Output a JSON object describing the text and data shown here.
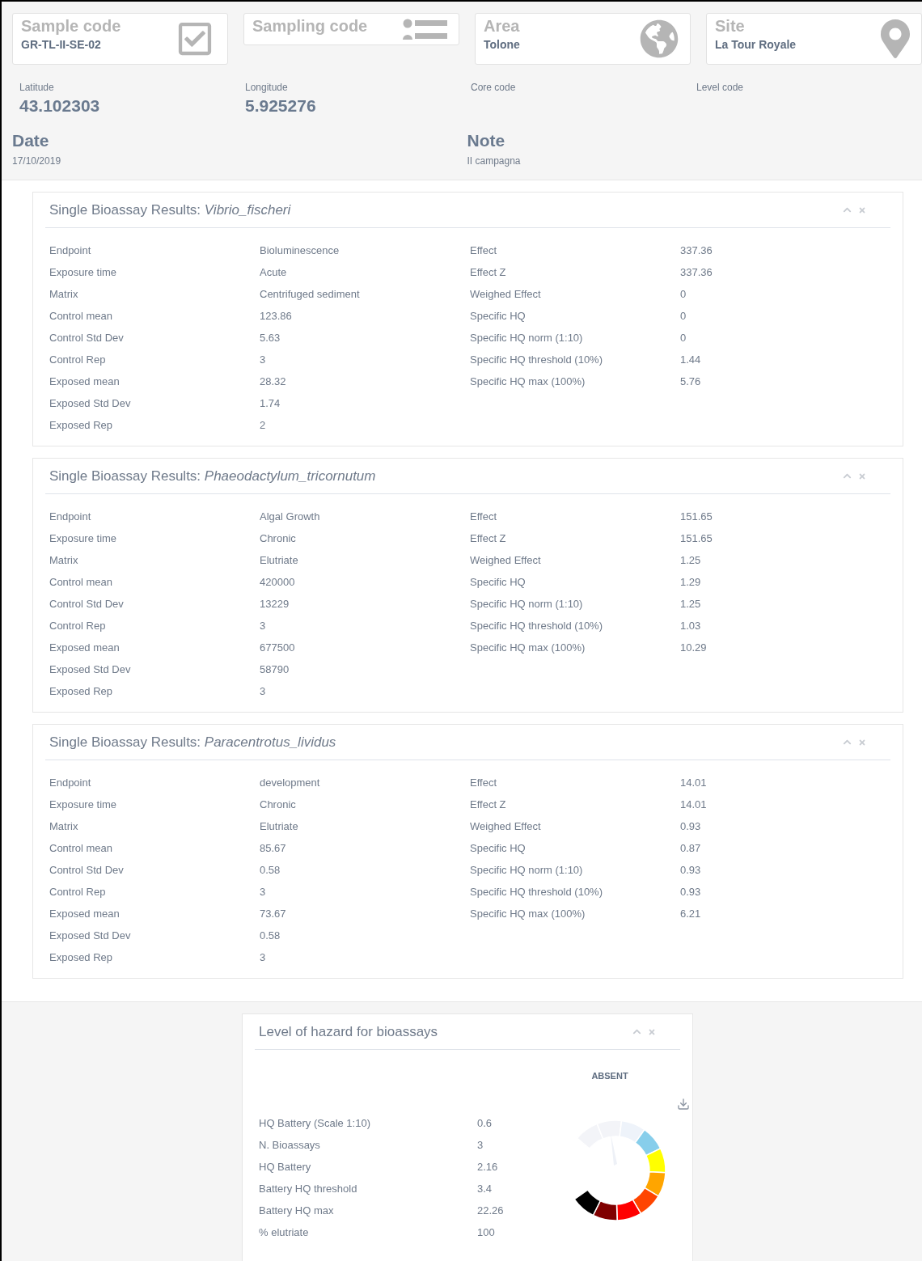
{
  "summary_cards": [
    {
      "kind": "check",
      "title": "Sample code",
      "value": "GR-TL-II-SE-02"
    },
    {
      "kind": "list",
      "title": "Sampling code"
    },
    {
      "kind": "globe",
      "title": "Area",
      "value": "Tolone"
    },
    {
      "kind": "pin",
      "title": "Site",
      "value": "La Tour Royale"
    }
  ],
  "coordinates": [
    {
      "label": "Latitude",
      "value": "43.102303"
    },
    {
      "label": "Longitude",
      "value": "5.925276"
    },
    {
      "label": "Core code"
    },
    {
      "label": "Level code"
    }
  ],
  "details": [
    {
      "label": "Date",
      "value": "17/10/2019"
    },
    {
      "label": "Note",
      "value": "II campagna"
    }
  ],
  "bioassay_panels": [
    {
      "title": "Single Bioassay Results: *Vibrio_fischeri*",
      "left_rows": [
        [
          "Endpoint",
          "Bioluminescence"
        ],
        [
          "Exposure time",
          "Acute"
        ],
        [
          "Matrix",
          "Centrifuged sediment"
        ],
        [
          "Control mean",
          "123.86"
        ],
        [
          "Control Std Dev",
          "5.63"
        ],
        [
          "Control Rep",
          "3"
        ],
        [
          "Exposed mean",
          "28.32"
        ],
        [
          "Exposed Std Dev",
          "1.74"
        ],
        [
          "Exposed Rep",
          "2"
        ]
      ],
      "right_rows": [
        [
          "Effect",
          "337.36"
        ],
        [
          "Effect Z",
          "337.36"
        ],
        [
          "Weighed Effect",
          "0"
        ],
        [
          "Specific HQ",
          "0"
        ],
        [
          "Specific HQ norm (1:10)",
          "0"
        ],
        [
          "Specific HQ threshold (10%)",
          "1.44"
        ],
        [
          "Specific HQ max (100%)",
          "5.76"
        ]
      ]
    },
    {
      "title": "Single Bioassay Results: *Phaeodactylum_tricornutum*",
      "left_rows": [
        [
          "Endpoint",
          "Algal Growth"
        ],
        [
          "Exposure time",
          "Chronic"
        ],
        [
          "Matrix",
          "Elutriate"
        ],
        [
          "Control mean",
          "420000"
        ],
        [
          "Control Std Dev",
          "13229"
        ],
        [
          "Control Rep",
          "3"
        ],
        [
          "Exposed mean",
          "677500"
        ],
        [
          "Exposed Std Dev",
          "58790"
        ],
        [
          "Exposed Rep",
          "3"
        ]
      ],
      "right_rows": [
        [
          "Effect",
          "151.65"
        ],
        [
          "Effect Z",
          "151.65"
        ],
        [
          "Weighed Effect",
          "1.25"
        ],
        [
          "Specific HQ",
          "1.29"
        ],
        [
          "Specific HQ norm (1:10)",
          "1.25"
        ],
        [
          "Specific HQ threshold (10%)",
          "1.03"
        ],
        [
          "Specific HQ max (100%)",
          "10.29"
        ]
      ]
    },
    {
      "title": "Single Bioassay Results: *Paracentrotus_lividus*",
      "left_rows": [
        [
          "Endpoint",
          "development"
        ],
        [
          "Exposure time",
          "Chronic"
        ],
        [
          "Matrix",
          "Elutriate"
        ],
        [
          "Control mean",
          "85.67"
        ],
        [
          "Control Std Dev",
          "0.58"
        ],
        [
          "Control Rep",
          "3"
        ],
        [
          "Exposed mean",
          "73.67"
        ],
        [
          "Exposed Std Dev",
          "0.58"
        ],
        [
          "Exposed Rep",
          "3"
        ]
      ],
      "right_rows": [
        [
          "Effect",
          "14.01"
        ],
        [
          "Effect Z",
          "14.01"
        ],
        [
          "Weighed Effect",
          "0.93"
        ],
        [
          "Specific HQ",
          "0.87"
        ],
        [
          "Specific HQ norm (1:10)",
          "0.93"
        ],
        [
          "Specific HQ threshold (10%)",
          "0.93"
        ],
        [
          "Specific HQ max (100%)",
          "6.21"
        ]
      ]
    }
  ],
  "hazard_panel": {
    "title": "Level of hazard for bioassays",
    "level_label": "ABSENT",
    "rows": [
      [
        "HQ Battery (Scale 1:10)",
        "0.6"
      ],
      [
        "N. Bioassays",
        "3"
      ],
      [
        "HQ Battery",
        "2.16"
      ],
      [
        "Battery HQ threshold",
        "3.4"
      ],
      [
        "Battery HQ max",
        "22.26"
      ],
      [
        "% elutriate",
        "100"
      ]
    ]
  }
}
